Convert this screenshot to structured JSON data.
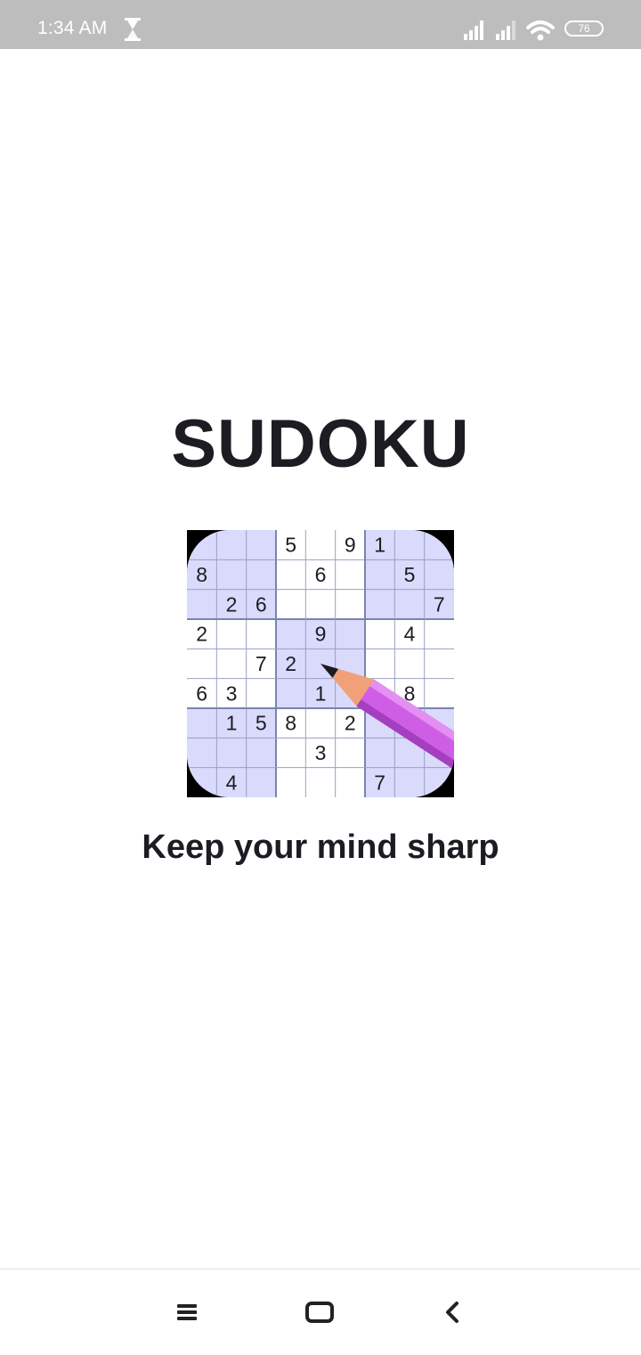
{
  "status_bar": {
    "time": "1:34 AM",
    "battery": "76",
    "icons": [
      "hourglass-icon",
      "signal-icon",
      "signal-icon",
      "wifi-icon",
      "battery-icon"
    ]
  },
  "app": {
    "title": "SUDOKU",
    "tagline": "Keep your mind sharp"
  },
  "logo": {
    "grid": [
      [
        "",
        "",
        "",
        "5",
        "",
        "9",
        "1",
        "",
        ""
      ],
      [
        "8",
        "",
        "",
        "",
        "6",
        "",
        "",
        "5",
        ""
      ],
      [
        "",
        "2",
        "6",
        "",
        "",
        "",
        "",
        "",
        "7"
      ],
      [
        "2",
        "",
        "",
        "",
        "9",
        "",
        "",
        "4",
        ""
      ],
      [
        "",
        "",
        "7",
        "2",
        "",
        "",
        "",
        "",
        ""
      ],
      [
        "6",
        "3",
        "",
        "",
        "1",
        "",
        "",
        "8",
        ""
      ],
      [
        "",
        "1",
        "5",
        "8",
        "",
        "2",
        "",
        "",
        ""
      ],
      [
        "",
        "",
        "",
        "",
        "3",
        "",
        "",
        "",
        ""
      ],
      [
        "",
        "4",
        "",
        "",
        "",
        "",
        "7",
        "",
        ""
      ]
    ],
    "colors": {
      "shaded_box": "#d9dafc",
      "grid_line": "#9aa0c4",
      "pencil_body": "#cf5ee6",
      "pencil_tip": "#f2a07a"
    }
  },
  "nav_bar": {
    "icons": [
      "menu-icon",
      "home-icon",
      "back-icon"
    ]
  }
}
